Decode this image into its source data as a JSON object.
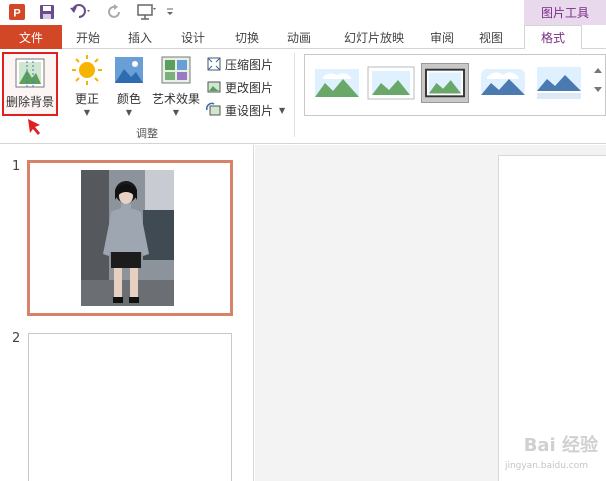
{
  "contextual_tab": {
    "label": "图片工具"
  },
  "tabs": [
    {
      "label": "文件"
    },
    {
      "label": "开始"
    },
    {
      "label": "插入"
    },
    {
      "label": "设计"
    },
    {
      "label": "切换"
    },
    {
      "label": "动画"
    },
    {
      "label": "幻灯片放映"
    },
    {
      "label": "审阅"
    },
    {
      "label": "视图"
    },
    {
      "label": "格式"
    }
  ],
  "ribbon": {
    "remove_background": "删除背景",
    "corrections": "更正",
    "color": "颜色",
    "artistic_effects": "艺术效果",
    "compress_pictures": "压缩图片",
    "change_picture": "更改图片",
    "reset_picture": "重设图片",
    "group_label": "调整"
  },
  "slides": [
    {
      "number": "1"
    },
    {
      "number": "2"
    }
  ],
  "watermark": {
    "text": "Bai 经验",
    "url": "jingyan.baidu.com"
  },
  "colors": {
    "file_tab": "#d24726",
    "accent": "#7a2b86",
    "highlight_red": "#e02020",
    "slide_selected_border": "#d9826a"
  }
}
